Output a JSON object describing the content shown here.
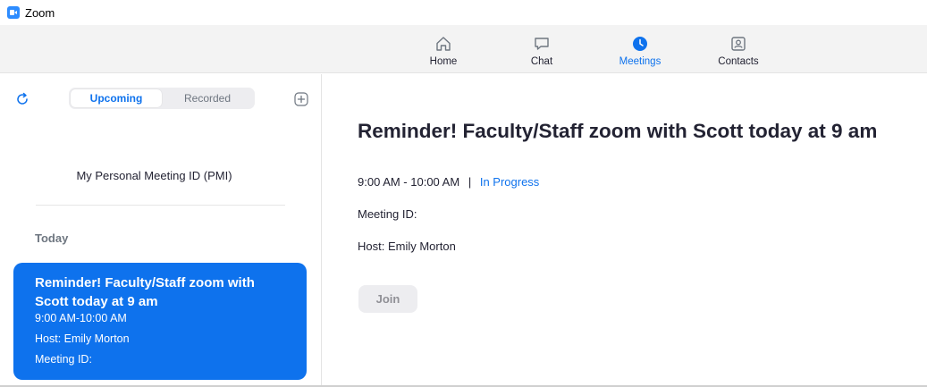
{
  "window": {
    "title": "Zoom"
  },
  "nav": {
    "items": [
      {
        "label": "Home",
        "icon": "home-icon",
        "active": false
      },
      {
        "label": "Chat",
        "icon": "chat-icon",
        "active": false
      },
      {
        "label": "Meetings",
        "icon": "clock-icon",
        "active": true
      },
      {
        "label": "Contacts",
        "icon": "contact-icon",
        "active": false
      }
    ]
  },
  "left": {
    "tabs": [
      {
        "label": "Upcoming",
        "active": true
      },
      {
        "label": "Recorded",
        "active": false
      }
    ],
    "pmi_label": "My Personal Meeting ID (PMI)",
    "section_today": "Today",
    "meetings": [
      {
        "title": "Reminder! Faculty/Staff zoom with Scott today at 9 am",
        "time": "9:00 AM-10:00 AM",
        "host": "Host: Emily Morton",
        "meeting_id": "Meeting ID:"
      }
    ]
  },
  "detail": {
    "title": "Reminder! Faculty/Staff zoom with Scott today at 9 am",
    "time": "9:00 AM - 10:00 AM",
    "separator": "|",
    "status": "In Progress",
    "meeting_id": "Meeting ID:",
    "host": "Host: Emily Morton",
    "join_label": "Join"
  },
  "colors": {
    "accent": "#0e72ed",
    "nav_bg": "#f3f3f3",
    "text": "#232333",
    "muted": "#6e7680"
  }
}
